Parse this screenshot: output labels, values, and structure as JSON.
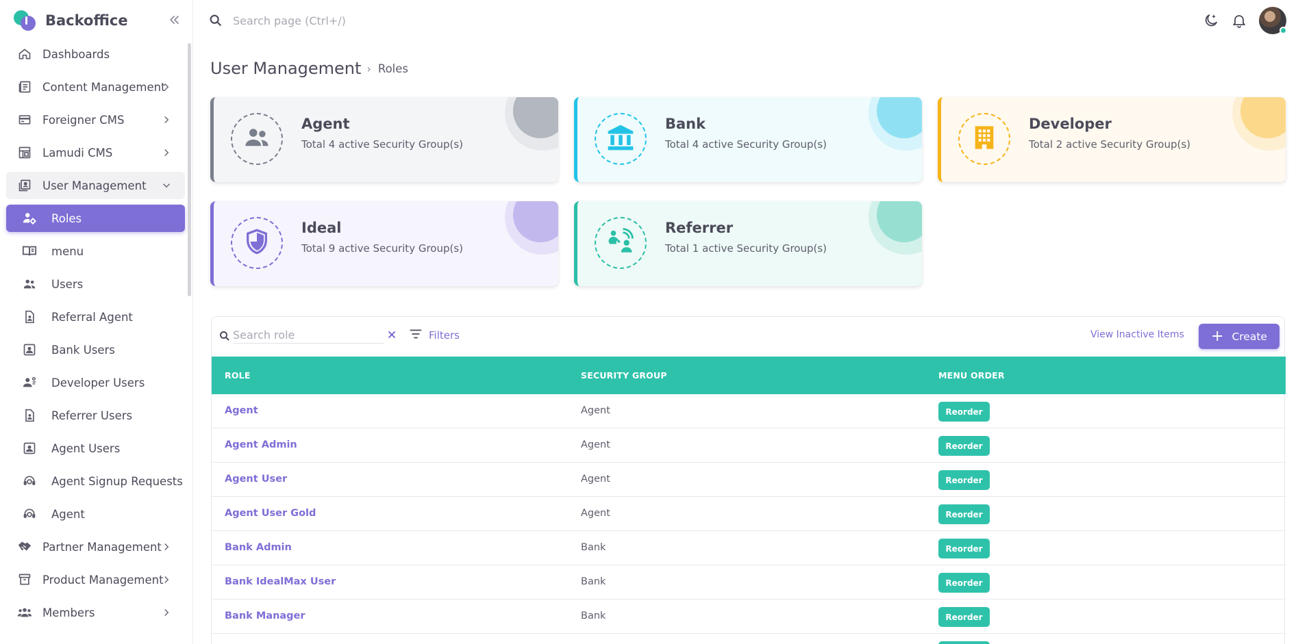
{
  "brand": {
    "name": "Backoffice"
  },
  "topbar": {
    "search_placeholder": "Search page (Ctrl+/)"
  },
  "sidebar": {
    "items": [
      {
        "label": "Dashboards",
        "icon": "home-icon"
      },
      {
        "label": "Content Management",
        "icon": "newspaper-icon"
      },
      {
        "label": "Foreigner CMS",
        "icon": "card-icon"
      },
      {
        "label": "Lamudi CMS",
        "icon": "layout-icon"
      },
      {
        "label": "User Management",
        "icon": "user-book-icon"
      },
      {
        "label": "Roles",
        "icon": "user-gear-icon"
      },
      {
        "label": "menu",
        "icon": "menu-book-icon"
      },
      {
        "label": "Users",
        "icon": "users-icon"
      },
      {
        "label": "Referral Agent",
        "icon": "contact-file-icon"
      },
      {
        "label": "Bank Users",
        "icon": "contact-box-icon"
      },
      {
        "label": "Developer Users",
        "icon": "user-settings-icon"
      },
      {
        "label": "Referrer Users",
        "icon": "contact-file-icon"
      },
      {
        "label": "Agent Users",
        "icon": "contact-box-icon"
      },
      {
        "label": "Agent Signup Requests",
        "icon": "support-agent-icon"
      },
      {
        "label": "Agent",
        "icon": "support-agent-icon"
      },
      {
        "label": "Partner Management",
        "icon": "handshake-icon"
      },
      {
        "label": "Product Management",
        "icon": "archive-icon"
      },
      {
        "label": "Members",
        "icon": "group-icon"
      }
    ]
  },
  "breadcrumb": {
    "main": "User Management",
    "separator": "›",
    "current": "Roles"
  },
  "cards": [
    {
      "title": "Agent",
      "subtitle": "Total 4 active Security Group(s)",
      "color": "#7a7f8c",
      "icon": "users-icon"
    },
    {
      "title": "Bank",
      "subtitle": "Total 4 active Security Group(s)",
      "color": "#22c3e6",
      "icon": "bank-icon"
    },
    {
      "title": "Developer",
      "subtitle": "Total 2 active Security Group(s)",
      "color": "#f5b41a",
      "icon": "building-icon"
    },
    {
      "title": "Ideal",
      "subtitle": "Total 9 active Security Group(s)",
      "color": "#7e6fd6",
      "icon": "shield-icon"
    },
    {
      "title": "Referrer",
      "subtitle": "Total 1 active Security Group(s)",
      "color": "#2bbfa7",
      "icon": "referral-icon"
    }
  ],
  "toolbar": {
    "search_placeholder": "Search role",
    "filters_label": "Filters",
    "view_inactive_label": "View Inactive Items",
    "create_label": "Create"
  },
  "table": {
    "columns": [
      "ROLE",
      "SECURITY GROUP",
      "MENU ORDER"
    ],
    "button_label": "Reorder",
    "rows": [
      {
        "role": "Agent",
        "group": "Agent"
      },
      {
        "role": "Agent Admin",
        "group": "Agent"
      },
      {
        "role": "Agent User",
        "group": "Agent"
      },
      {
        "role": "Agent User Gold",
        "group": "Agent"
      },
      {
        "role": "Bank Admin",
        "group": "Bank"
      },
      {
        "role": "Bank IdealMax User",
        "group": "Bank"
      },
      {
        "role": "Bank Manager",
        "group": "Bank"
      }
    ]
  }
}
